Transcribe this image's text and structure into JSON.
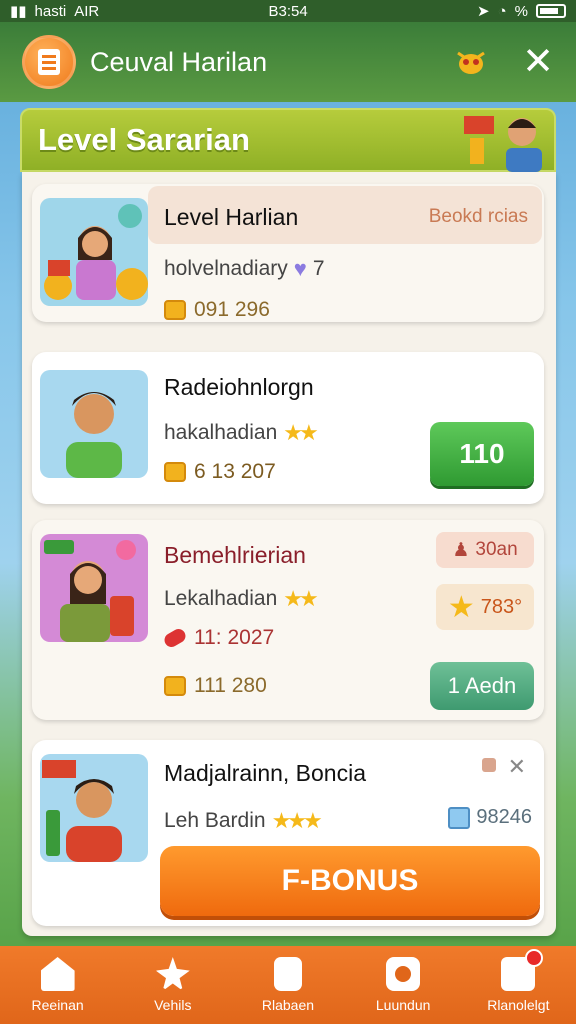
{
  "status_bar": {
    "left_text": "hasti",
    "network": "AIR",
    "time": "B3:54",
    "indicators": "%"
  },
  "header": {
    "title": "Ceuval Harilan",
    "logo_icon": "notes-icon",
    "mascot_icon": "bug-icon",
    "close_icon": "close-icon"
  },
  "banner": {
    "title": "Level Sararian"
  },
  "cards": [
    {
      "title": "Level Harlian",
      "badge": "Beokd rcias",
      "subtitle": "holvelnadiary",
      "subtitle_suffix": "7",
      "stat": "091 296",
      "accent": "#8b6a2c"
    },
    {
      "title": "Radeiohnlorgn",
      "subtitle": "hakalhadian",
      "stat": "6 13 207",
      "button_label": "110"
    },
    {
      "title": "Bemehlrierian",
      "subtitle": "Lekalhadian",
      "stat_secondary": "11: 2027",
      "stat": "111 280",
      "tag": "30an",
      "star_value": "783°",
      "button_label": "1 Aedn"
    },
    {
      "title": "Madjalrainn, Boncia",
      "subtitle": "Leh Bardin",
      "gift_value": "98246",
      "bonus_label": "F-BONUS"
    }
  ],
  "bottom_nav": [
    {
      "label": "Reeinan",
      "icon": "home-icon"
    },
    {
      "label": "Vehils",
      "icon": "chat-bubble-icon"
    },
    {
      "label": "Rlabaen",
      "icon": "document-icon"
    },
    {
      "label": "Luundun",
      "icon": "camera-icon"
    },
    {
      "label": "Rlanolelgt",
      "icon": "phone-icon"
    }
  ],
  "colors": {
    "header_green": "#3b7d39",
    "banner_lime": "#a8c232",
    "primary_orange": "#ef6a0e",
    "action_green": "#2f9a32"
  }
}
